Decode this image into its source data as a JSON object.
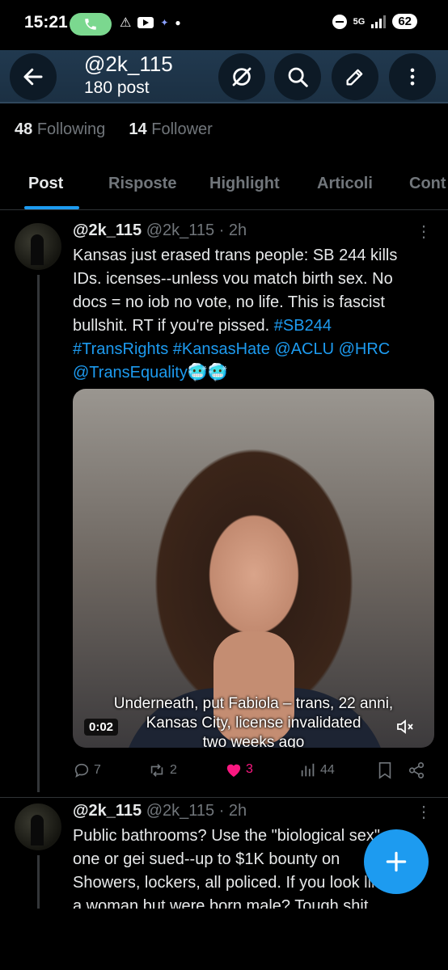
{
  "status_bar": {
    "time": "15:21",
    "network": "5G",
    "battery": "62"
  },
  "header": {
    "title": "@2k_115",
    "subtitle": "180 post"
  },
  "stats": {
    "following_count": "48",
    "following_label": "Following",
    "followers_count": "14",
    "followers_label": "Follower"
  },
  "tabs": [
    {
      "label": "Post"
    },
    {
      "label": "Risposte"
    },
    {
      "label": "Highlight"
    },
    {
      "label": "Articoli"
    },
    {
      "label": "Cont"
    }
  ],
  "posts": [
    {
      "display_name": "@2k_115",
      "handle": "@2k_115",
      "time": "· 2h",
      "text_lines": [
        "Kansas just erased trans people: SB 244 kills",
        "IDs. icenses--unless vou match birth sex. No",
        "docs = no iob no vote, no life. This is fascist",
        "bullshit. RT if you're pissed."
      ],
      "hashtag1": "#SB244",
      "tags_line": "#TransRights #KansasHate @ACLU @HRC",
      "last_line": "@TransEquality🥶🥶",
      "media": {
        "caption_line1": "Underneath, put Fabiola – trans, 22 anni,",
        "caption_line2": "Kansas City, license invalidated",
        "caption_line3": "two weeks ago",
        "timecode": "0:02"
      },
      "metrics": {
        "replies": "7",
        "reposts": "2",
        "likes": "3",
        "views": "44"
      }
    },
    {
      "display_name": "@2k_115",
      "handle": "@2k_115",
      "time": "· 2h",
      "text_lines": [
        "Public bathrooms? Use the \"biological sex\"",
        "one or gei sued--up to $1K bounty on",
        "Showers, lockers, all policed. If you look like",
        "a woman but were born male? Tough shit"
      ]
    }
  ],
  "colors": {
    "accent": "#1d9bf0",
    "like": "#f91880",
    "header_bg": "#1e3448"
  }
}
